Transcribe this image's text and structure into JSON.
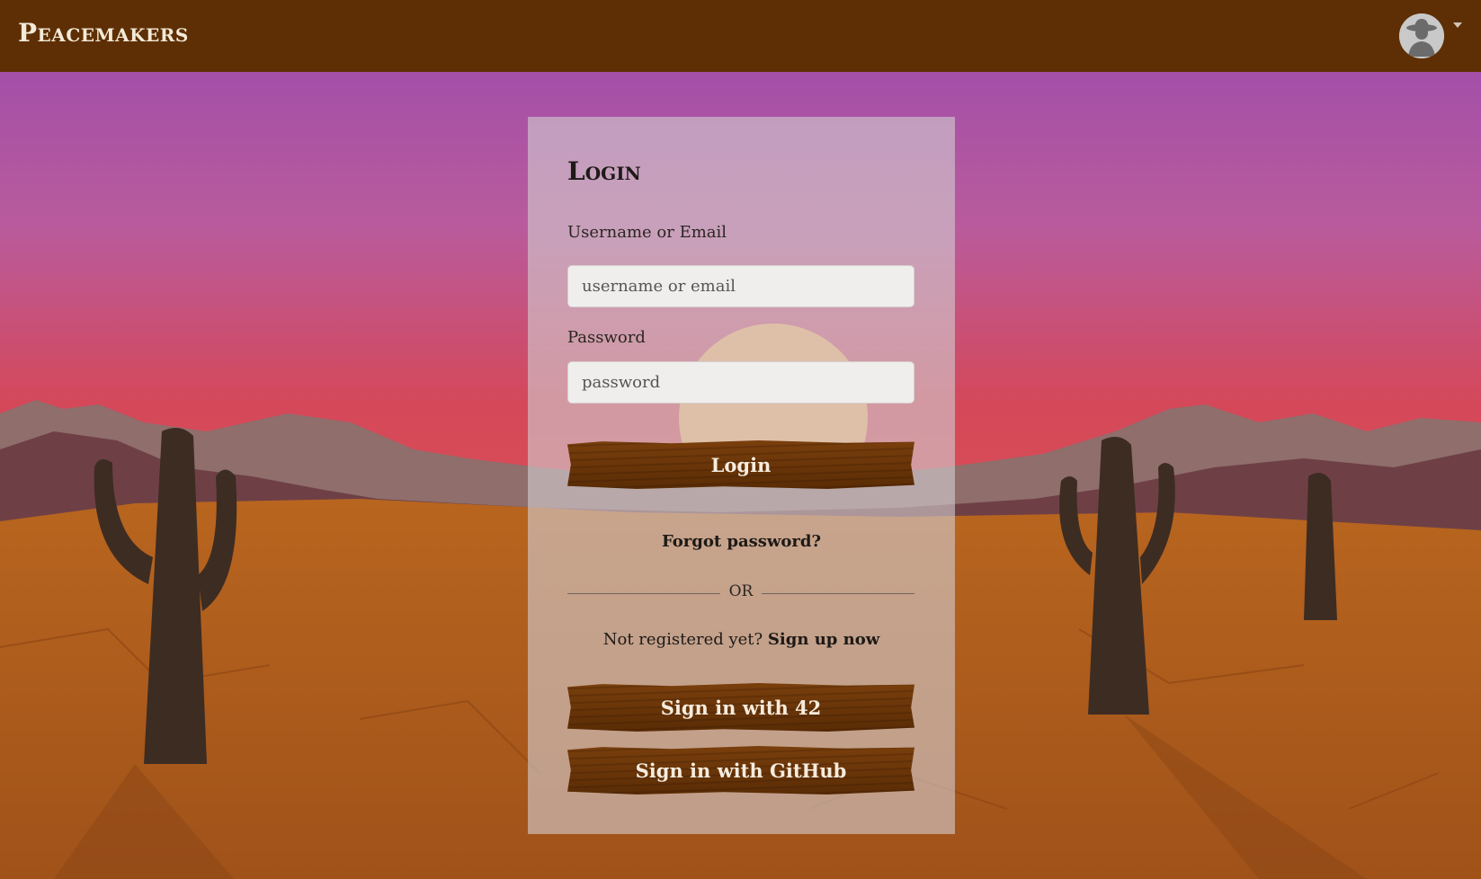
{
  "navbar": {
    "brand": "Peacemakers",
    "avatar_icon": "cowboy-avatar-icon",
    "menu_icon": "chevron-down-icon"
  },
  "login": {
    "title": "Login",
    "username_label": "Username or Email",
    "username_placeholder": "username or email",
    "password_label": "Password",
    "password_placeholder": "password",
    "login_button": "Login",
    "forgot_password": "Forgot password?",
    "divider_text": "OR",
    "not_registered": "Not registered yet?",
    "signup_link": "Sign up now",
    "sign_in_42": "Sign in with 42",
    "sign_in_github": "Sign in with GitHub"
  },
  "colors": {
    "navbar": "#5e2f04",
    "button_wood": "#6a3508",
    "sky_top": "#9a4aae",
    "sky_bottom": "#d4485a",
    "desert": "#a85a1f"
  }
}
